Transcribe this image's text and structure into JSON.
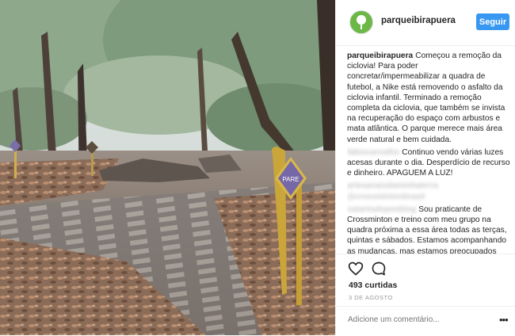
{
  "post": {
    "photo_alt": "Ciclovia do Parque Ibirapuera com folhas secas e placa PARE",
    "sign_text": "PARE"
  },
  "header": {
    "username": "parqueibirapuera",
    "follow_label": "Seguir"
  },
  "comments": [
    {
      "user": "parqueibirapuera",
      "user_blurred": false,
      "text": "Começou a remoção da ciclovia! Para poder concretar/impermeabilizar a quadra de futebol, a Nike está removendo o asfalto da ciclovia infantil. Terminado a remoção completa da ciclovia, que também se invista na recuperação do espaço com arbustos e mata atlântica. O parque merece mais área verde natural e bem cuidada."
    },
    {
      "user": "fabiocarvalho",
      "user_blurred": true,
      "text": "Continuo vendo várias luzes acesas durante o dia. Desperdício de recurso e dinheiro. APAGUEM A LUZ!"
    },
    {
      "user": "artesanaisdaminhaterra @crossmintonbrasil",
      "user_blurred": true,
      "text": "",
      "line_only": true
    },
    {
      "user": "catarinalopesblog",
      "user_blurred": true,
      "text": "Sou praticante de Crossminton e treino com meu grupo na quadra próxima a essa área todas as terças, quintas e sábados. Estamos acompanhando as mudanças, mas estamos preocupados com o que será feito do nosso espaço que é compartilhado com"
    }
  ],
  "footer": {
    "likes": "493 curtidas",
    "date": "3 de agosto",
    "comment_placeholder": "Adicione um comentário...",
    "more_label": "•••"
  },
  "icons": {
    "like": "heart-icon",
    "comment": "comment-icon",
    "avatar": "tree-logo"
  },
  "colors": {
    "follow_button": "#3897f0",
    "avatar": "#6bb847"
  }
}
